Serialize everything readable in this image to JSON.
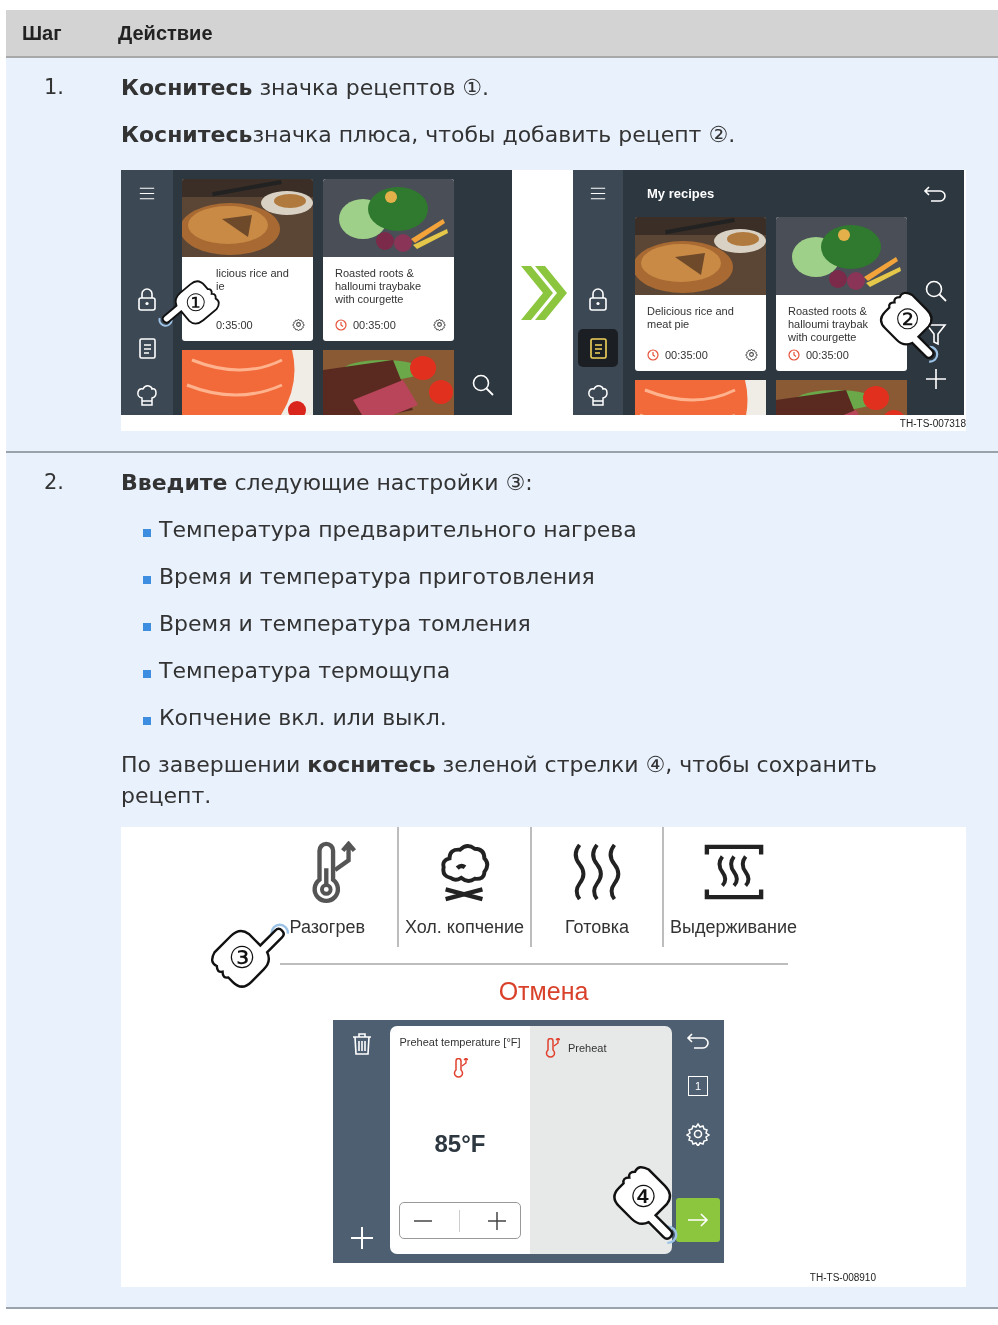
{
  "table": {
    "columns": [
      "Шаг",
      "Действие"
    ],
    "rows": [
      {
        "step": "1.",
        "paragraphs": [
          "**Коснитесь** значка рецептов ①.",
          "**Коснитесь**значка плюса, чтобы добавить рецепт ②."
        ],
        "figure": {
          "code": "TH-TS-007318",
          "screens": [
            {
              "sidebar_items": [
                {
                  "selected": false
                },
                {
                  "selected": false
                },
                {
                  "selected": false
                }
              ],
              "cards": [
                {
                  "title_lines": [
                    "licious rice and",
                    "ie"
                  ],
                  "time": "0:35:00",
                  "clock": false,
                  "gear": true
                },
                {
                  "title_lines": [
                    "Roasted roots &",
                    "halloumi traybake",
                    "with courgette"
                  ],
                  "time": "00:35:00",
                  "clock": true,
                  "gear": true
                }
              ],
              "hand": "①"
            },
            {
              "title": "My recipes",
              "sidebar_items": [
                {
                  "selected": false
                },
                {
                  "selected": true
                },
                {
                  "selected": false
                }
              ],
              "cards": [
                {
                  "title_lines": [
                    "Delicious rice and",
                    "meat pie"
                  ],
                  "time": "00:35:00",
                  "clock": true,
                  "gear": true
                },
                {
                  "title_lines": [
                    "Roasted roots &",
                    "halloumi traybak",
                    "with courgette"
                  ],
                  "time": "00:35:00",
                  "clock": true,
                  "gear": false
                }
              ],
              "hand": "②"
            }
          ]
        }
      },
      {
        "step": "2.",
        "paragraphs": [
          "**Введите** следующие настройки ③:"
        ],
        "bullets": [
          "Температура предварительного нагрева",
          "Время и температура приготовления",
          "Время и температура томления",
          "Температура термощупа",
          "Копчение вкл. или выкл."
        ],
        "closing": "По завершении **коснитесь** зеленой стрелки ④, чтобы сохранить рецепт.",
        "figure": {
          "code": "TH-TS-008910",
          "modes": [
            "Разогрев",
            "Хол. копчение",
            "Готовка",
            "Выдерживание"
          ],
          "cancel": "Отмена",
          "hand_top": "③",
          "screen": {
            "field_label": "Preheat temperature [°F]",
            "value": "85°F",
            "step_name": "Preheat",
            "tray": "1",
            "hand": "④"
          }
        }
      }
    ]
  }
}
